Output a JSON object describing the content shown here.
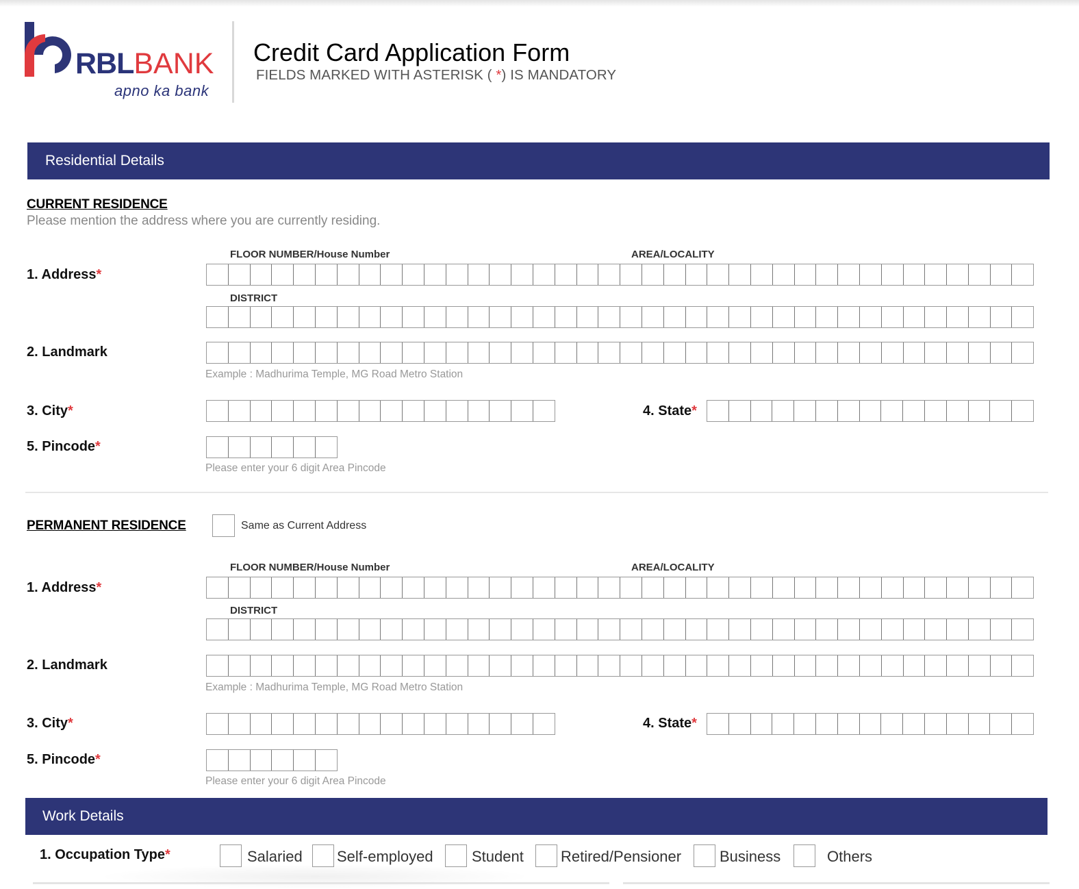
{
  "header": {
    "logo": {
      "brand_part1": "RBL",
      "brand_part2": "BANK",
      "tagline": "apno ka bank"
    },
    "title": "Credit Card Application Form",
    "subtitle_prefix": "FIELDS MARKED WITH ASTERISK ( ",
    "subtitle_asterisk": "*",
    "subtitle_suffix": ") IS MANDATORY"
  },
  "colors": {
    "brand_blue": "#2d3577",
    "brand_red": "#e03a3e"
  },
  "residential": {
    "bar_label": "Residential Details",
    "current": {
      "heading": "CURRENT RESIDENCE",
      "note": "Please mention the address where you are currently residing.",
      "address_label": "1. Address",
      "floor_label": "FLOOR NUMBER/House Number",
      "area_label": "AREA/LOCALITY",
      "district_label": "DISTRICT",
      "landmark_label": "2. Landmark",
      "landmark_hint": "Example  : Madhurima Temple, MG Road Metro Station",
      "city_label": "3. City",
      "state_label": "4. State",
      "pincode_label": "5. Pincode",
      "pincode_hint": "Please enter your 6 digit Area Pincode",
      "required_mark": "*"
    },
    "permanent": {
      "heading": "PERMANENT RESIDENCE",
      "same_as_current_label": "Same as Current Address",
      "same_as_current_checked": false,
      "address_label": "1. Address",
      "floor_label": "FLOOR NUMBER/House Number",
      "area_label": "AREA/LOCALITY",
      "district_label": "DISTRICT",
      "landmark_label": "2. Landmark",
      "landmark_hint": "Example  : Madhurima Temple, MG Road Metro Station",
      "city_label": "3. City",
      "state_label": "4. State",
      "pincode_label": "5. Pincode",
      "pincode_hint": "Please enter your 6 digit Area Pincode",
      "required_mark": "*"
    },
    "box_counts": {
      "address_line": 38,
      "district_line": 38,
      "landmark": 38,
      "city": 16,
      "state": 15,
      "pincode": 6
    }
  },
  "work": {
    "bar_label": "Work Details",
    "occupation_label": "1. Occupation Type",
    "required_mark": "*",
    "occupation_options": [
      {
        "label": "Salaried",
        "checked": false
      },
      {
        "label": "Self-employed",
        "checked": false
      },
      {
        "label": "Student",
        "checked": false
      },
      {
        "label": "Retired/Pensioner",
        "checked": false
      },
      {
        "label": "Business",
        "checked": false
      },
      {
        "label": "Others",
        "checked": false
      }
    ]
  }
}
